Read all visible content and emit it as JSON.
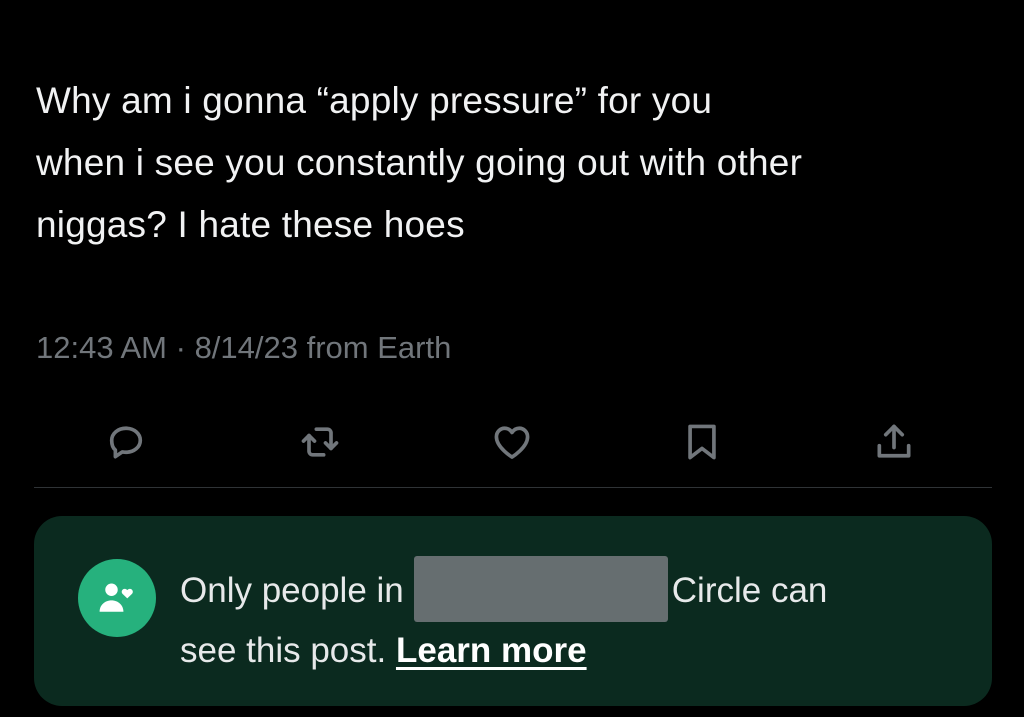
{
  "tweet": {
    "text_lines": [
      "Why am i gonna “apply pressure” for you",
      "when i see you constantly going out with other",
      "niggas? I hate these hoes"
    ],
    "time": "12:43 AM",
    "separator": "·",
    "date": "8/14/23",
    "source": "from Earth"
  },
  "actions": {
    "icons": [
      "reply-icon",
      "repost-icon",
      "like-icon",
      "bookmark-icon",
      "share-icon"
    ],
    "color": "#71767b"
  },
  "circle_notice": {
    "prefix": "Only people in",
    "suffix": "Circle can",
    "line2_text": "see this post.",
    "learn_more": "Learn more",
    "badge_icon": "circle-people-icon",
    "badge_color": "#26b17d",
    "background_color": "#0b2a1f"
  }
}
